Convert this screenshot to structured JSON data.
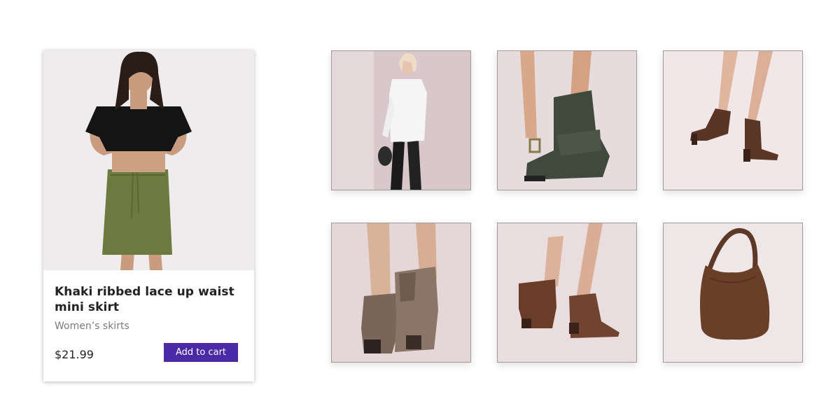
{
  "product": {
    "title": "Khaki ribbed lace up waist mini skirt",
    "category": "Women’s skirts",
    "price": "$21.99",
    "add_to_cart_label": "Add to cart",
    "image_icon": "model-in-khaki-skirt-photo"
  },
  "related_items": [
    {
      "icon": "model-white-shirt-photo"
    },
    {
      "icon": "green-fringe-ankle-boot-photo"
    },
    {
      "icon": "brown-fringe-ankle-boots-photo"
    },
    {
      "icon": "taupe-chelsea-boot-photo"
    },
    {
      "icon": "brown-suede-ankle-boots-photo"
    },
    {
      "icon": "brown-suede-hobo-bag-photo"
    }
  ],
  "colors": {
    "accent": "#4a2aa6",
    "tile_background": "#e4d8da"
  }
}
